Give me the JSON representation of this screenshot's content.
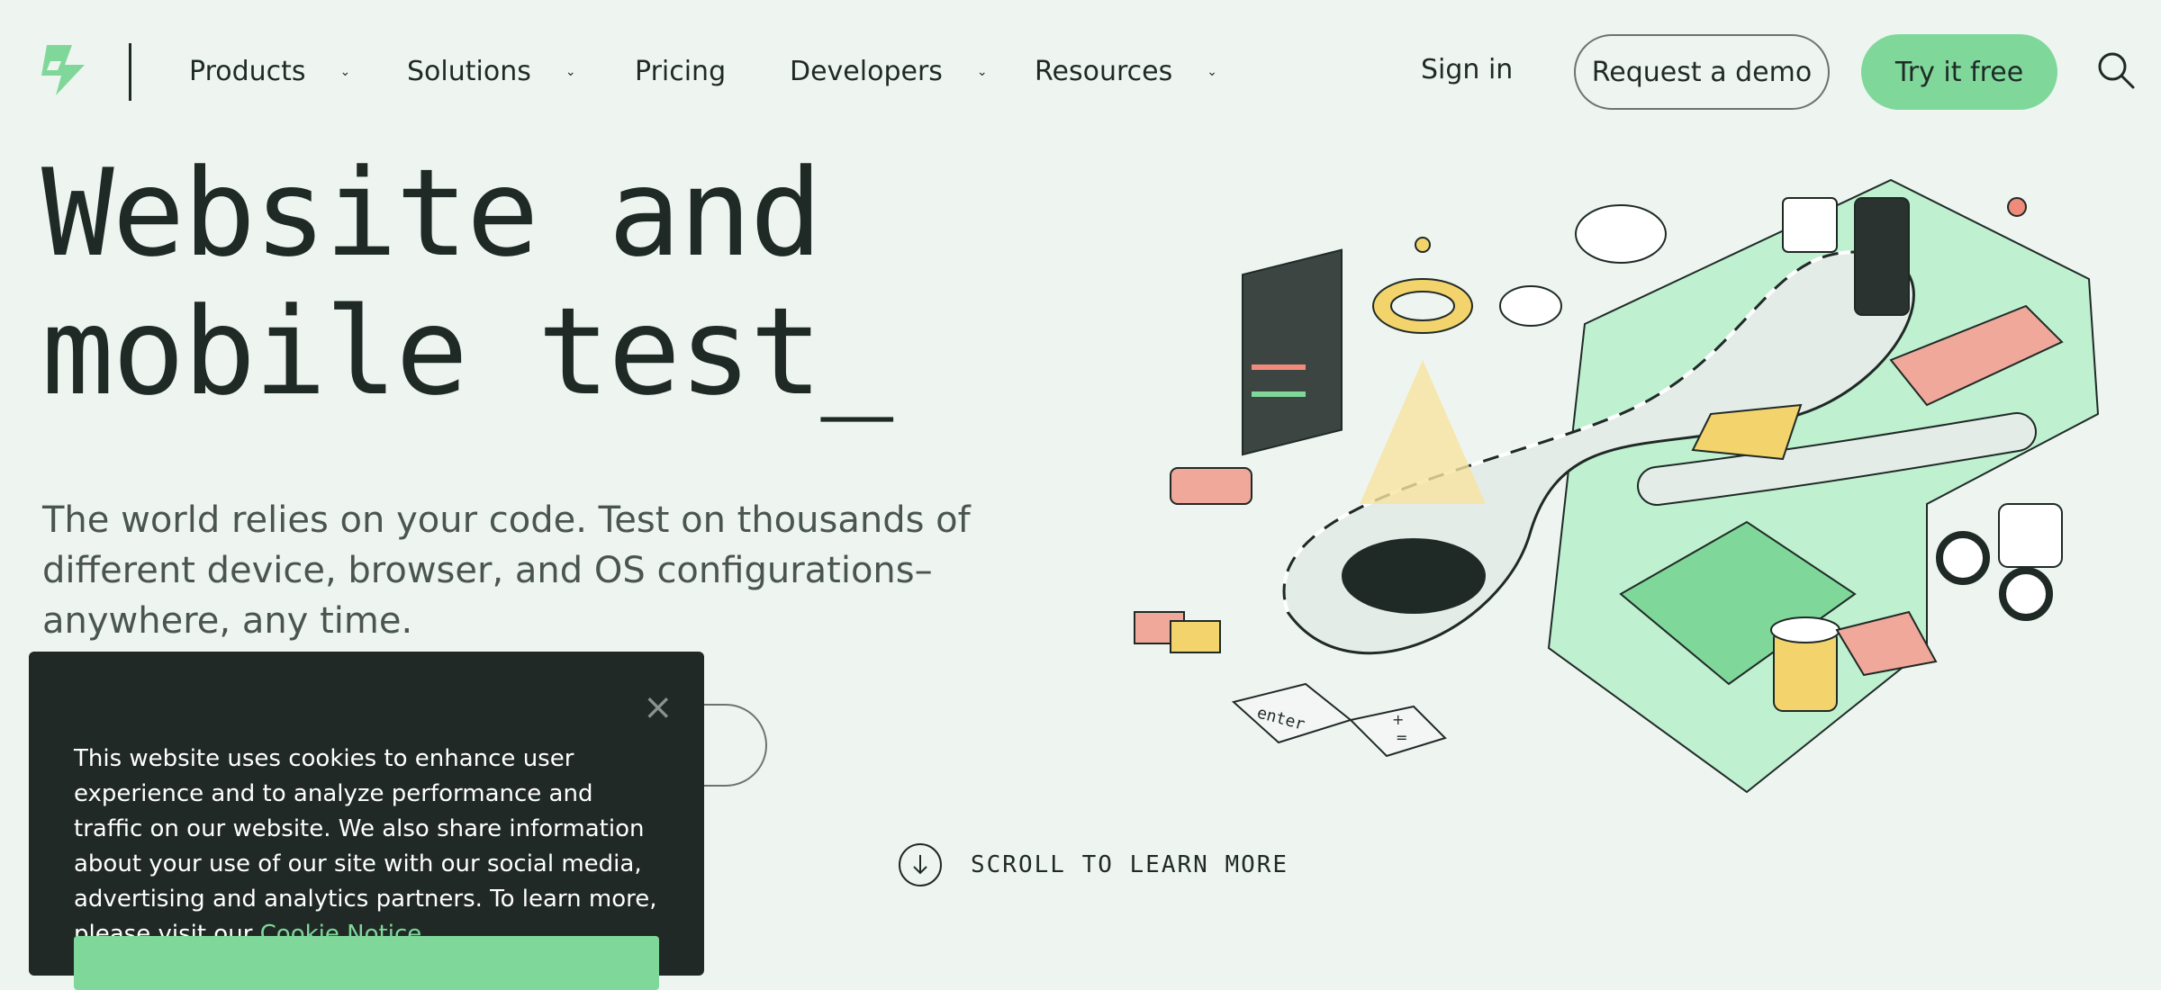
{
  "nav": {
    "items": [
      {
        "label": "Products",
        "has_dropdown": true
      },
      {
        "label": "Solutions",
        "has_dropdown": true
      },
      {
        "label": "Pricing",
        "has_dropdown": false
      },
      {
        "label": "Developers",
        "has_dropdown": true
      },
      {
        "label": "Resources",
        "has_dropdown": true
      }
    ],
    "signin": "Sign in",
    "request_demo": "Request a demo",
    "try_free": "Try it free"
  },
  "hero": {
    "headline_line1": "Website and",
    "headline_line2": "mobile test_",
    "subtitle": "The world relies on your code. Test on thousands of different device, browser, and OS configurations–anywhere, any time.",
    "scroll_label": "SCROLL TO LEARN MORE"
  },
  "illustration": {
    "enter_key": "enter",
    "plus_key": "+",
    "equals_key": "="
  },
  "cookie": {
    "close": "×",
    "text": "This website uses cookies to enhance user experience and to analyze performance and traffic on our website. We also share information about your use of our site with our social media, advertising and analytics partners. To learn more, please visit our",
    "link": "Cookie Notice"
  },
  "colors": {
    "accent": "#7fd89a",
    "background": "#eef5f1",
    "text": "#1f2a27",
    "cookie_bg": "#212926"
  }
}
